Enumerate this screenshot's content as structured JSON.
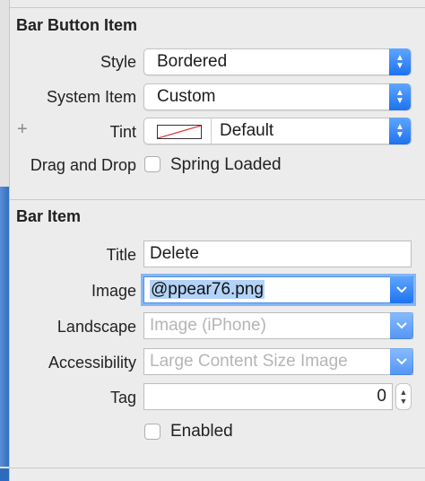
{
  "bar_button_item": {
    "section_title": "Bar Button Item",
    "style": {
      "label": "Style",
      "value": "Bordered"
    },
    "system_item": {
      "label": "System Item",
      "value": "Custom"
    },
    "tint": {
      "plus": "+",
      "label": "Tint",
      "value": "Default"
    },
    "drag_drop": {
      "label": "Drag and Drop",
      "checkbox_label": "Spring Loaded",
      "checked": false
    }
  },
  "bar_item": {
    "section_title": "Bar Item",
    "title": {
      "label": "Title",
      "value": "Delete"
    },
    "image": {
      "label": "Image",
      "value": "@ppear76.png"
    },
    "landscape": {
      "label": "Landscape",
      "placeholder": "Image (iPhone)"
    },
    "accessibility": {
      "label": "Accessibility",
      "placeholder": "Large Content Size Image"
    },
    "tag": {
      "label": "Tag",
      "value": "0"
    },
    "enabled": {
      "label": "Enabled",
      "checked": false
    }
  },
  "colors": {
    "accent": "#1d72f0",
    "selection": "#b3d2f7",
    "focus_ring": "#86b6f5"
  }
}
